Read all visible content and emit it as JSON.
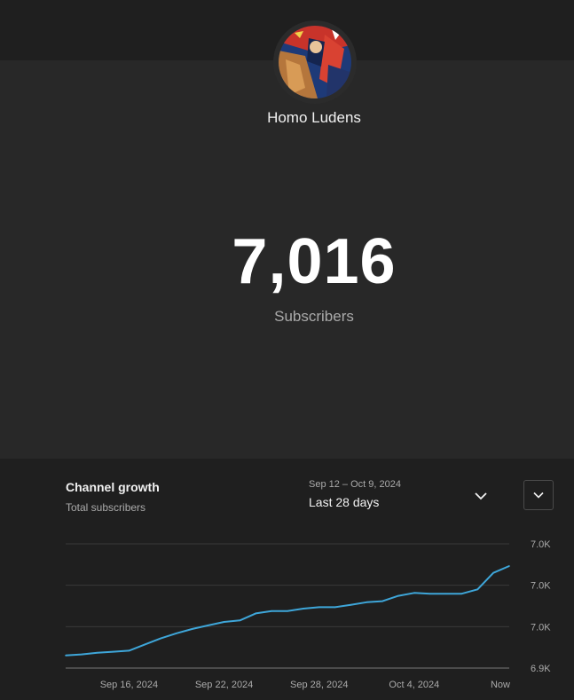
{
  "channel": {
    "name": "Homo Ludens",
    "subscriber_count": "7,016",
    "subscriber_label": "Subscribers"
  },
  "growth": {
    "title": "Channel growth",
    "subtitle": "Total subscribers",
    "date_range": "Sep 12 – Oct 9, 2024",
    "range_label": "Last 28 days"
  },
  "icons": {
    "range": "chevron-down-icon",
    "collapse": "chevron-down-icon"
  },
  "colors": {
    "line": "#3ea6d9",
    "grid": "#3a3a3a",
    "axis": "#777777"
  },
  "chart_data": {
    "type": "line",
    "x": [
      "Sep 12",
      "Sep 13",
      "Sep 14",
      "Sep 15",
      "Sep 16",
      "Sep 17",
      "Sep 18",
      "Sep 19",
      "Sep 20",
      "Sep 21",
      "Sep 22",
      "Sep 23",
      "Sep 24",
      "Sep 25",
      "Sep 26",
      "Sep 27",
      "Sep 28",
      "Sep 29",
      "Sep 30",
      "Oct 1",
      "Oct 2",
      "Oct 3",
      "Oct 4",
      "Oct 5",
      "Oct 6",
      "Oct 7",
      "Oct 8",
      "Oct 9"
    ],
    "series": [
      {
        "values": [
          6936.1,
          6936.6,
          6937.4,
          6937.9,
          6938.4,
          6941.4,
          6944.3,
          6946.8,
          6948.9,
          6950.6,
          6952.3,
          6953.0,
          6956.4,
          6957.5,
          6957.5,
          6958.7,
          6959.4,
          6959.4,
          6960.5,
          6961.8,
          6962.3,
          6964.9,
          6966.3,
          6965.9,
          6965.9,
          6965.9,
          6968.0,
          6976.0,
          6979.3
        ]
      }
    ],
    "x_ticks": [
      {
        "label": "Sep 16, 2024",
        "x": 4
      },
      {
        "label": "Sep 22, 2024",
        "x": 10
      },
      {
        "label": "Sep 28, 2024",
        "x": 16
      },
      {
        "label": "Oct 4, 2024",
        "x": 22
      },
      {
        "label": "Now",
        "x": 28
      }
    ],
    "y_ticks": [
      {
        "label": "7.0K",
        "value": 6990
      },
      {
        "label": "7.0K",
        "value": 6970
      },
      {
        "label": "7.0K",
        "value": 6950
      },
      {
        "label": "6.9K",
        "value": 6930
      }
    ],
    "ylim": [
      6930,
      6990
    ],
    "grid": true
  }
}
